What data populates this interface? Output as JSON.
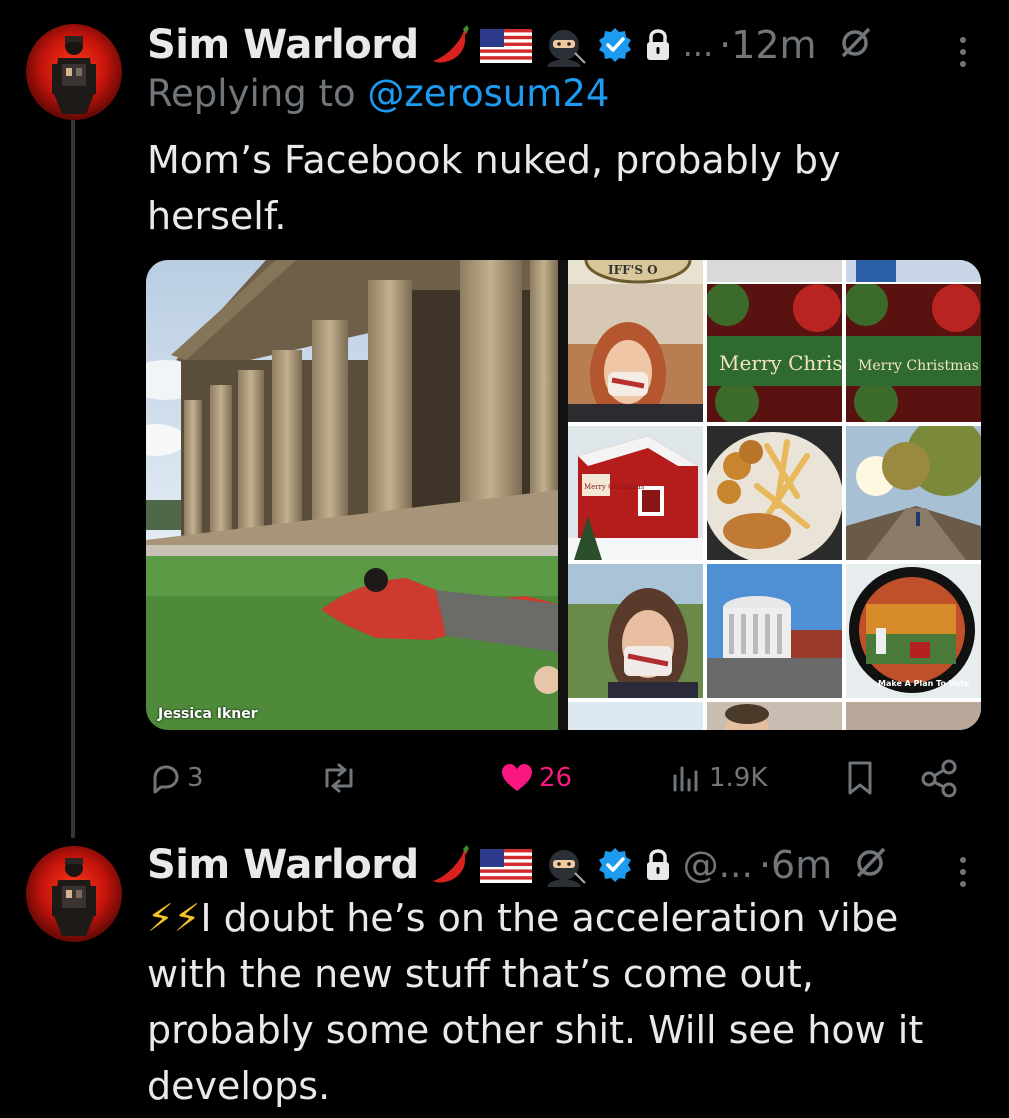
{
  "tweets": [
    {
      "author_name": "Sim Warlord",
      "truncation": "...",
      "time": "·12m",
      "reply_prefix": "Replying to ",
      "reply_handle": "@zerosum24",
      "text": "Mom’s Facebook nuked, probably by herself.",
      "media": {
        "left_photo_caption": "Jessica Ikner",
        "collage_cells": [
          {
            "label": "IFF'S O"
          },
          {
            "label": "Merry Christmas"
          },
          {
            "label": "Merry Christmas"
          },
          {
            "label": "Merry Christmas"
          },
          {
            "label": "Make A Plan To Vote"
          }
        ]
      },
      "actions": {
        "replies": "3",
        "reposts": "",
        "likes": "26",
        "views": "1.9K"
      }
    },
    {
      "author_name": "Sim Warlord",
      "truncation": "@...",
      "time": "·6m",
      "lead_emoji": "⚡⚡",
      "text": "I doubt he’s on the acceleration vibe with the new stuff that’s come out, probably some other shit. Will see how it develops."
    }
  ],
  "icons": {
    "badges": [
      "chili-pepper-icon",
      "us-flag-icon",
      "ninja-icon",
      "verified-badge-icon",
      "lock-icon"
    ],
    "actions": [
      "reply-icon",
      "repost-icon",
      "like-icon",
      "views-icon",
      "bookmark-icon",
      "share-icon"
    ]
  },
  "colors": {
    "background": "#000000",
    "text": "#e7e9ea",
    "secondary": "#71767b",
    "link": "#1d9bf0",
    "like": "#f91880",
    "verified": "#1d9bf0"
  }
}
